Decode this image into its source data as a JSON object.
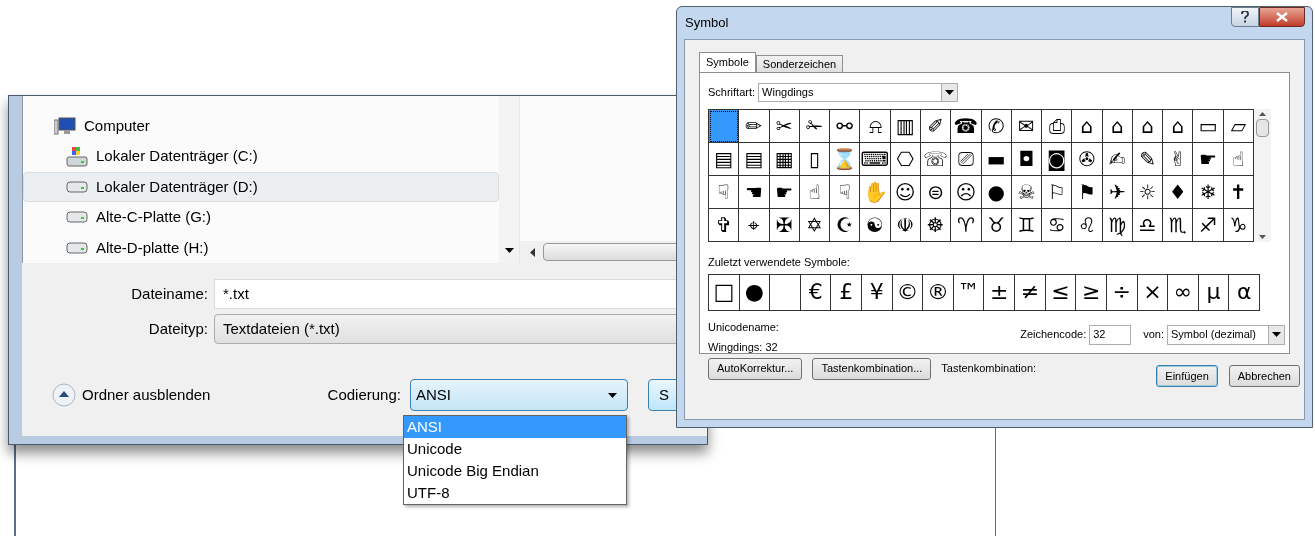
{
  "save_dialog": {
    "tree": [
      {
        "label": "Computer",
        "kind": "computer",
        "selected": false,
        "children": [
          {
            "label": "Lokaler Datenträger (C:)",
            "kind": "system-drive",
            "selected": false
          },
          {
            "label": "Lokaler Datenträger (D:)",
            "kind": "drive",
            "selected": true
          },
          {
            "label": "Alte-C-Platte (G:)",
            "kind": "drive",
            "selected": false
          },
          {
            "label": "Alte-D-platte (H:)",
            "kind": "drive",
            "selected": false
          }
        ]
      }
    ],
    "filename": {
      "label": "Dateiname:",
      "value": "*.txt"
    },
    "filetype": {
      "label": "Dateityp:",
      "value": "Textdateien (*.txt)"
    },
    "hide_folders": "Ordner ausblenden",
    "encoding": {
      "label": "Codierung:",
      "value": "ANSI",
      "expanded": true,
      "options": [
        {
          "label": "ANSI",
          "selected": true
        },
        {
          "label": "Unicode",
          "selected": false
        },
        {
          "label": "Unicode Big Endian",
          "selected": false
        },
        {
          "label": "UTF-8",
          "selected": false
        }
      ]
    },
    "save_button": "S"
  },
  "symbol_dialog": {
    "title": "Symbol",
    "tabs": [
      {
        "label": "Symbole",
        "selected": true
      },
      {
        "label": "Sonderzeichen",
        "selected": false
      }
    ],
    "font": {
      "label": "Schriftart:",
      "value": "Wingdings"
    },
    "symbols": [
      {
        "kind": "blank",
        "selected": true
      },
      {
        "kind": "glyph",
        "char": "✏",
        "selected": false
      },
      {
        "kind": "glyph",
        "char": "✂",
        "selected": false
      },
      {
        "kind": "glyph",
        "char": "✁",
        "selected": false
      },
      {
        "kind": "glyph",
        "char": "⚯",
        "selected": false
      },
      {
        "kind": "glyph",
        "char": "⍾",
        "selected": false
      },
      {
        "kind": "glyph",
        "char": "▥",
        "selected": false
      },
      {
        "kind": "glyph",
        "char": "✐",
        "selected": false
      },
      {
        "kind": "glyph",
        "char": "☎",
        "selected": false
      },
      {
        "kind": "glyph",
        "char": "✆",
        "selected": false
      },
      {
        "kind": "glyph",
        "char": "✉",
        "selected": false
      },
      {
        "kind": "glyph",
        "char": "⎙",
        "selected": false
      },
      {
        "kind": "glyph",
        "char": "⌂",
        "selected": false
      },
      {
        "kind": "glyph",
        "char": "⌂",
        "selected": false
      },
      {
        "kind": "glyph",
        "char": "⌂",
        "selected": false
      },
      {
        "kind": "glyph",
        "char": "⌂",
        "selected": false
      },
      {
        "kind": "glyph",
        "char": "▭",
        "selected": false
      },
      {
        "kind": "glyph",
        "char": "⏥",
        "selected": false
      },
      {
        "kind": "glyph",
        "char": "▤",
        "selected": false
      },
      {
        "kind": "glyph",
        "char": "▤",
        "selected": false
      },
      {
        "kind": "glyph",
        "char": "▦",
        "selected": false
      },
      {
        "kind": "glyph",
        "char": "▯",
        "selected": false
      },
      {
        "kind": "glyph",
        "char": "⌛",
        "selected": false
      },
      {
        "kind": "glyph",
        "char": "⌨",
        "selected": false
      },
      {
        "kind": "glyph",
        "char": "⎔",
        "selected": false
      },
      {
        "kind": "glyph",
        "char": "☏",
        "selected": false
      },
      {
        "kind": "glyph",
        "char": "⎚",
        "selected": false
      },
      {
        "kind": "glyph",
        "char": "▬",
        "selected": false
      },
      {
        "kind": "glyph",
        "char": "◘",
        "selected": false
      },
      {
        "kind": "glyph",
        "char": "◙",
        "selected": false
      },
      {
        "kind": "glyph",
        "char": "✇",
        "selected": false
      },
      {
        "kind": "glyph",
        "char": "✍",
        "selected": false
      },
      {
        "kind": "glyph",
        "char": "✎",
        "selected": false
      },
      {
        "kind": "glyph",
        "char": "✌",
        "selected": false
      },
      {
        "kind": "glyph",
        "char": "☛",
        "selected": false
      },
      {
        "kind": "glyph",
        "char": "☝",
        "selected": false
      },
      {
        "kind": "glyph",
        "char": "☟",
        "selected": false
      },
      {
        "kind": "glyph",
        "char": "☚",
        "selected": false
      },
      {
        "kind": "glyph",
        "char": "☛",
        "selected": false
      },
      {
        "kind": "glyph",
        "char": "☝",
        "selected": false
      },
      {
        "kind": "glyph",
        "char": "☟",
        "selected": false
      },
      {
        "kind": "glyph",
        "char": "✋",
        "selected": false
      },
      {
        "kind": "glyph",
        "char": "☺",
        "selected": false
      },
      {
        "kind": "glyph",
        "char": "⊜",
        "selected": false
      },
      {
        "kind": "glyph",
        "char": "☹",
        "selected": false
      },
      {
        "kind": "glyph",
        "char": "●",
        "selected": false
      },
      {
        "kind": "glyph",
        "char": "☠",
        "selected": false
      },
      {
        "kind": "glyph",
        "char": "⚐",
        "selected": false
      },
      {
        "kind": "glyph",
        "char": "⚑",
        "selected": false
      },
      {
        "kind": "glyph",
        "char": "✈",
        "selected": false
      },
      {
        "kind": "glyph",
        "char": "☼",
        "selected": false
      },
      {
        "kind": "glyph",
        "char": "♦",
        "selected": false
      },
      {
        "kind": "glyph",
        "char": "❄",
        "selected": false
      },
      {
        "kind": "glyph",
        "char": "✝",
        "selected": false
      },
      {
        "kind": "glyph",
        "char": "✞",
        "selected": false
      },
      {
        "kind": "glyph",
        "char": "⌖",
        "selected": false
      },
      {
        "kind": "glyph",
        "char": "✠",
        "selected": false
      },
      {
        "kind": "glyph",
        "char": "✡",
        "selected": false
      },
      {
        "kind": "glyph",
        "char": "☪",
        "selected": false
      },
      {
        "kind": "glyph",
        "char": "☯",
        "selected": false
      },
      {
        "kind": "glyph",
        "char": "☫",
        "selected": false
      },
      {
        "kind": "glyph",
        "char": "☸",
        "selected": false
      },
      {
        "kind": "glyph",
        "char": "♈",
        "selected": false
      },
      {
        "kind": "glyph",
        "char": "♉",
        "selected": false
      },
      {
        "kind": "glyph",
        "char": "♊",
        "selected": false
      },
      {
        "kind": "glyph",
        "char": "♋",
        "selected": false
      },
      {
        "kind": "glyph",
        "char": "♌",
        "selected": false
      },
      {
        "kind": "glyph",
        "char": "♍",
        "selected": false
      },
      {
        "kind": "glyph",
        "char": "♎",
        "selected": false
      },
      {
        "kind": "glyph",
        "char": "♏",
        "selected": false
      },
      {
        "kind": "glyph",
        "char": "♐",
        "selected": false
      },
      {
        "kind": "glyph",
        "char": "♑",
        "selected": false
      }
    ],
    "recent_label": "Zuletzt verwendete Symbole:",
    "recent": [
      {
        "kind": "glyph",
        "char": "□"
      },
      {
        "kind": "glyph",
        "char": "●"
      },
      {
        "kind": "blank"
      },
      {
        "kind": "glyph",
        "char": "€"
      },
      {
        "kind": "glyph",
        "char": "£"
      },
      {
        "kind": "glyph",
        "char": "¥"
      },
      {
        "kind": "glyph",
        "char": "©"
      },
      {
        "kind": "glyph",
        "char": "®"
      },
      {
        "kind": "glyph",
        "char": "™"
      },
      {
        "kind": "glyph",
        "char": "±"
      },
      {
        "kind": "glyph",
        "char": "≠"
      },
      {
        "kind": "glyph",
        "char": "≤"
      },
      {
        "kind": "glyph",
        "char": "≥"
      },
      {
        "kind": "glyph",
        "char": "÷"
      },
      {
        "kind": "glyph",
        "char": "×"
      },
      {
        "kind": "glyph",
        "char": "∞"
      },
      {
        "kind": "glyph",
        "char": "μ"
      },
      {
        "kind": "glyph",
        "char": "α"
      }
    ],
    "unicode_name_label": "Unicodename:",
    "unicode_name": "Wingdings: 32",
    "char_code": {
      "label": "Zeichencode:",
      "value": "32"
    },
    "from": {
      "label": "von:",
      "value": "Symbol (dezimal)"
    },
    "buttons": [
      "AutoKorrektur...",
      "Tastenkombination..."
    ],
    "shortcut_label": "Tastenkombination:",
    "insert": "Einfügen",
    "cancel": "Abbrechen"
  }
}
